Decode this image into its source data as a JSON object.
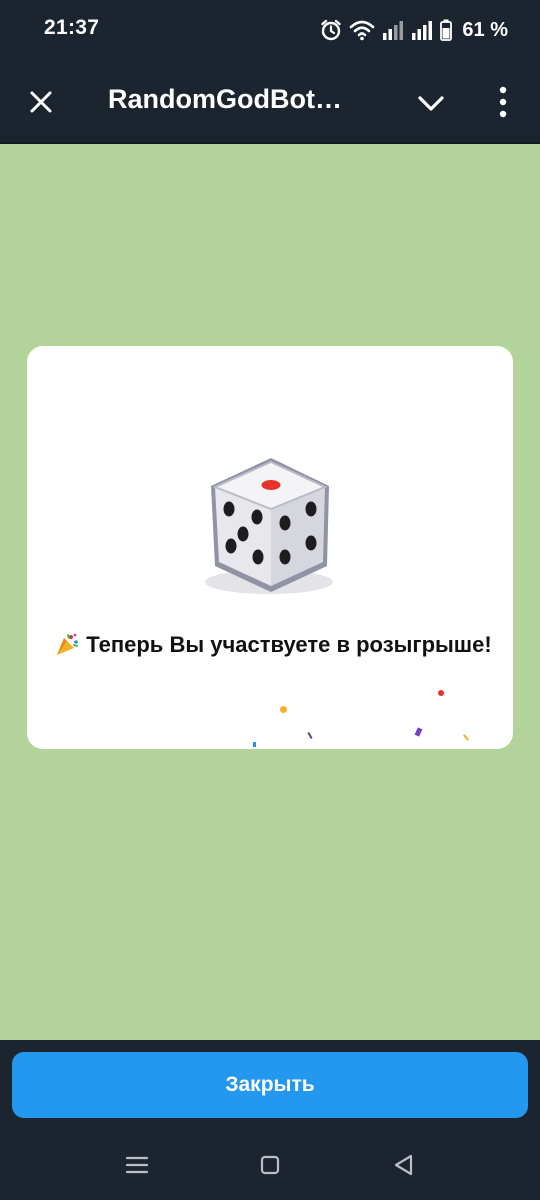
{
  "status_bar": {
    "time": "21:37",
    "battery_percent": "61 %",
    "icons": [
      "alarm-icon",
      "wifi-icon",
      "signal-icon",
      "signal-icon",
      "battery-icon"
    ]
  },
  "header": {
    "title": "RandomGodBot…",
    "close_icon": "close-icon",
    "collapse_icon": "chevron-down-icon",
    "more_icon": "more-vertical-icon"
  },
  "card": {
    "image_icon": "dice-icon",
    "emoji_icon": "party-popper-icon",
    "message": "Теперь Вы участвуете в розыгрыше!"
  },
  "bottom": {
    "close_button_label": "Закрыть"
  },
  "colors": {
    "app_background": "#1c242f",
    "webview_background": "#b2d49a",
    "card_background": "#ffffff",
    "button_accent": "#2497ef",
    "dice_pip_red": "#e8332d"
  },
  "navigation": [
    "menu-icon",
    "home-icon",
    "back-icon"
  ]
}
